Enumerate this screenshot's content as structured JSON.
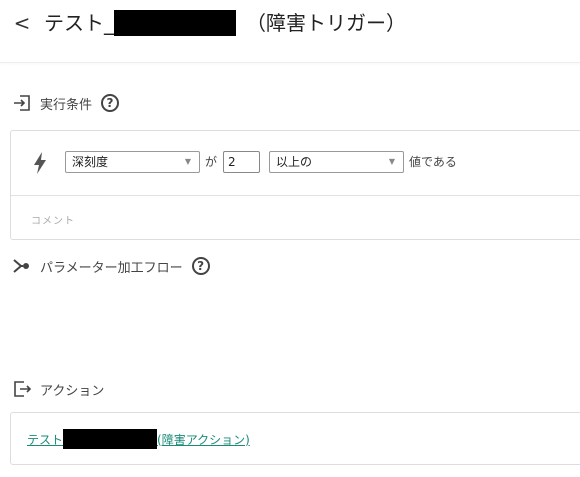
{
  "header": {
    "back_label": "<",
    "title_prefix": "テスト_",
    "title_suffix": "（障害トリガー）"
  },
  "conditions_section": {
    "title": "実行条件",
    "help": "?"
  },
  "condition": {
    "field_select": "深刻度",
    "connector": "が",
    "value": "2",
    "operator_select": "以上の",
    "suffix": "値である",
    "comment_placeholder": "コメント"
  },
  "flow_section": {
    "title": "パラメーター加工フロー",
    "help": "?"
  },
  "action_section": {
    "title": "アクション",
    "link_prefix": "テスト",
    "link_suffix": "(障害アクション)"
  }
}
